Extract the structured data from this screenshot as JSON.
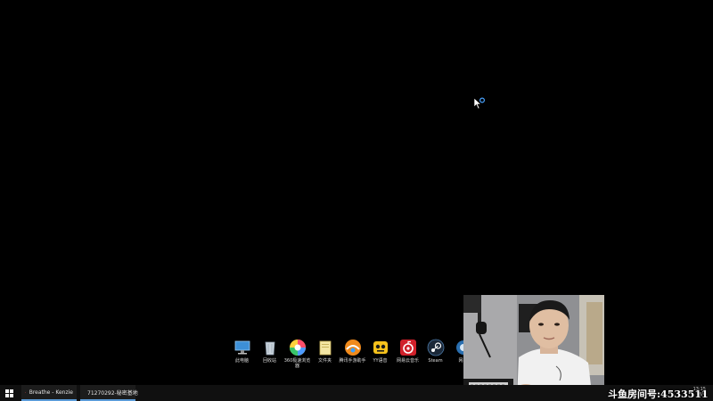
{
  "desktop": {
    "background_color": "#000000",
    "icons": [
      {
        "label": "此电脑",
        "icon": "this-pc-icon"
      },
      {
        "label": "回收站",
        "icon": "recycle-bin-icon"
      },
      {
        "label": "360极速浏览器",
        "icon": "360-browser-icon"
      },
      {
        "label": "文件夹",
        "icon": "folder-icon"
      },
      {
        "label": "腾讯手游助手",
        "icon": "tencent-mobile-assistant-icon"
      },
      {
        "label": "YY语音",
        "icon": "yy-voice-icon"
      },
      {
        "label": "网易云音乐",
        "icon": "netease-music-icon"
      },
      {
        "label": "Steam",
        "icon": "steam-icon"
      },
      {
        "label": "网易",
        "icon": "netease-icon"
      }
    ]
  },
  "taskbar": {
    "start_icon": "windows-logo-icon",
    "items": [
      {
        "label": "Breathe - Kenzie",
        "icon": "netease-music-icon"
      },
      {
        "label": "71270292-秘密基地",
        "icon": "yy-voice-icon"
      }
    ],
    "clock": {
      "time": "13:15",
      "date": "8/6"
    }
  },
  "overlay": {
    "room_number": "斗鱼房间号:4533511"
  },
  "colors": {
    "accent": "#5a9bd8",
    "netease_red": "#d0202a",
    "taskbar": "#101010"
  }
}
